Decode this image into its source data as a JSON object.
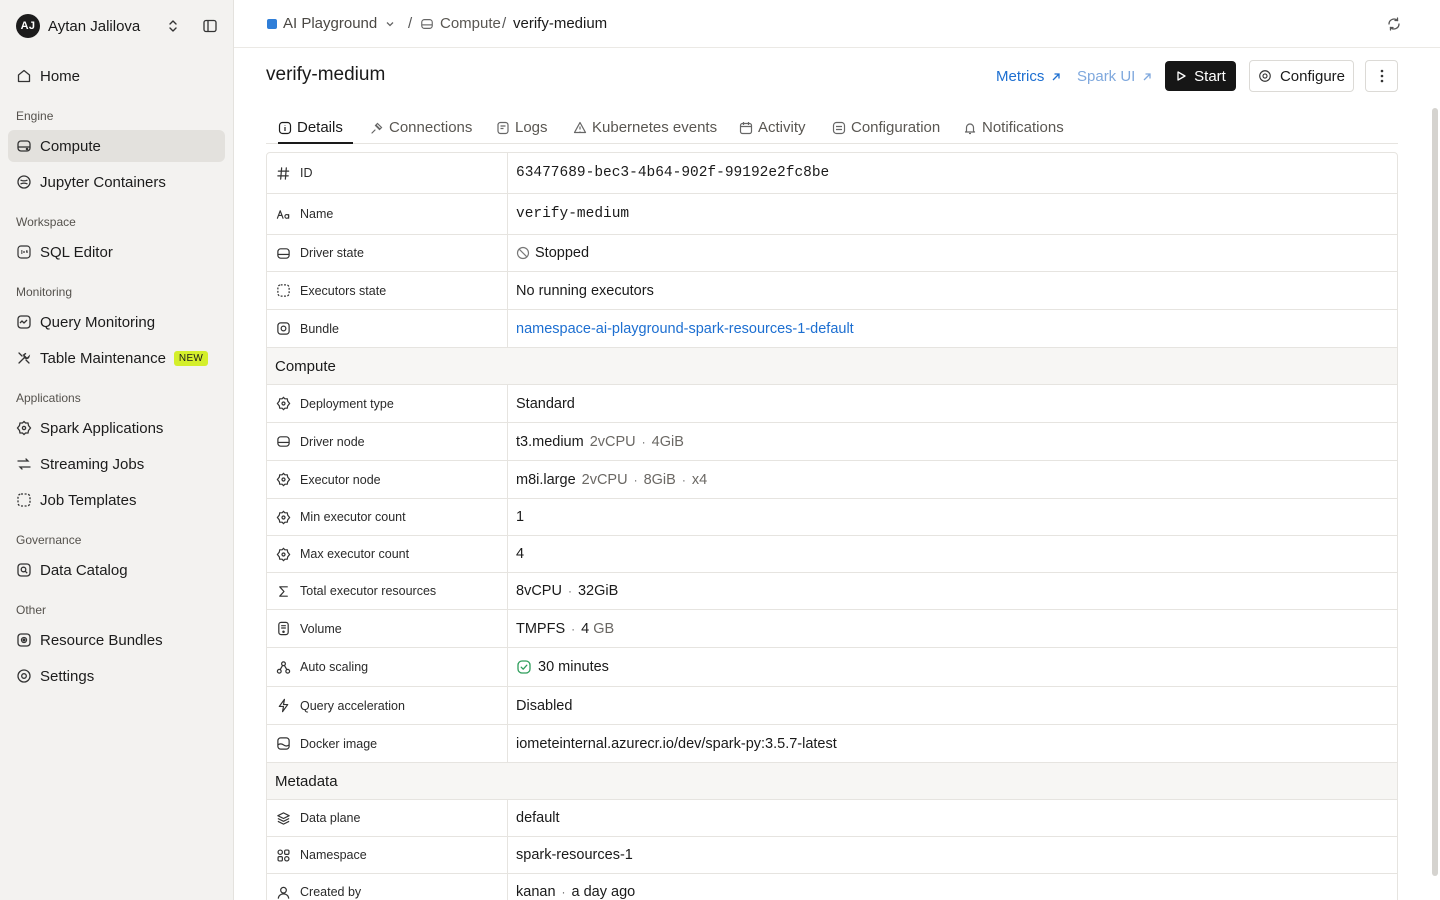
{
  "user": {
    "initials": "AJ",
    "name": "Aytan Jalilova"
  },
  "sidebar": {
    "home": "Home",
    "sections": {
      "engine": "Engine",
      "workspace": "Workspace",
      "monitoring": "Monitoring",
      "applications": "Applications",
      "governance": "Governance",
      "other": "Other"
    },
    "items": {
      "compute": "Compute",
      "jupyter": "Jupyter Containers",
      "sql_editor": "SQL Editor",
      "query_monitoring": "Query Monitoring",
      "table_maintenance": "Table Maintenance",
      "table_maintenance_badge": "NEW",
      "spark_applications": "Spark Applications",
      "streaming_jobs": "Streaming Jobs",
      "job_templates": "Job Templates",
      "data_catalog": "Data Catalog",
      "resource_bundles": "Resource Bundles",
      "settings": "Settings"
    }
  },
  "breadcrumb": {
    "project": "AI Playground",
    "separator": "/",
    "section": "Compute",
    "current": "verify-medium"
  },
  "header": {
    "title": "verify-medium",
    "metrics": "Metrics",
    "spark_ui": "Spark UI",
    "start": "Start",
    "configure": "Configure"
  },
  "tabs": {
    "details": "Details",
    "connections": "Connections",
    "logs": "Logs",
    "kubernetes_events": "Kubernetes events",
    "activity": "Activity",
    "configuration": "Configuration",
    "notifications": "Notifications"
  },
  "details": {
    "id": {
      "label": "ID",
      "value": "63477689-bec3-4b64-902f-99192e2fc8be"
    },
    "name": {
      "label": "Name",
      "value": "verify-medium"
    },
    "driver_state": {
      "label": "Driver state",
      "value": "Stopped"
    },
    "executors_state": {
      "label": "Executors state",
      "value": "No running executors"
    },
    "bundle": {
      "label": "Bundle",
      "value": "namespace-ai-playground-spark-resources-1-default"
    }
  },
  "compute": {
    "section_title": "Compute",
    "deployment_type": {
      "label": "Deployment type",
      "value": "Standard"
    },
    "driver_node": {
      "label": "Driver node",
      "value": "t3.medium",
      "cpu": "2vCPU",
      "mem": "4GiB"
    },
    "executor_node": {
      "label": "Executor node",
      "value": "m8i.large",
      "cpu": "2vCPU",
      "mem": "8GiB",
      "count": "x4"
    },
    "min_executor_count": {
      "label": "Min executor count",
      "value": "1"
    },
    "max_executor_count": {
      "label": "Max executor count",
      "value": "4"
    },
    "total_executor_resources": {
      "label": "Total executor resources",
      "cpu": "8vCPU",
      "mem": "32GiB"
    },
    "volume": {
      "label": "Volume",
      "type": "TMPFS",
      "size": "4",
      "unit": "GB"
    },
    "auto_scaling": {
      "label": "Auto scaling",
      "value": "30 minutes"
    },
    "query_acceleration": {
      "label": "Query acceleration",
      "value": "Disabled"
    },
    "docker_image": {
      "label": "Docker image",
      "value": "iometeinternal.azurecr.io/dev/spark-py:3.5.7-latest"
    }
  },
  "metadata": {
    "section_title": "Metadata",
    "data_plane": {
      "label": "Data plane",
      "value": "default"
    },
    "namespace": {
      "label": "Namespace",
      "value": "spark-resources-1"
    },
    "created_by": {
      "label": "Created by",
      "user": "kanan",
      "when": "a day ago"
    }
  },
  "dot_separator": "·",
  "colors": {
    "accent_link": "#1d6fd1",
    "badge_new": "#d4ef2b",
    "success": "#2e9e5b",
    "project_square": "#2f7ed8"
  }
}
